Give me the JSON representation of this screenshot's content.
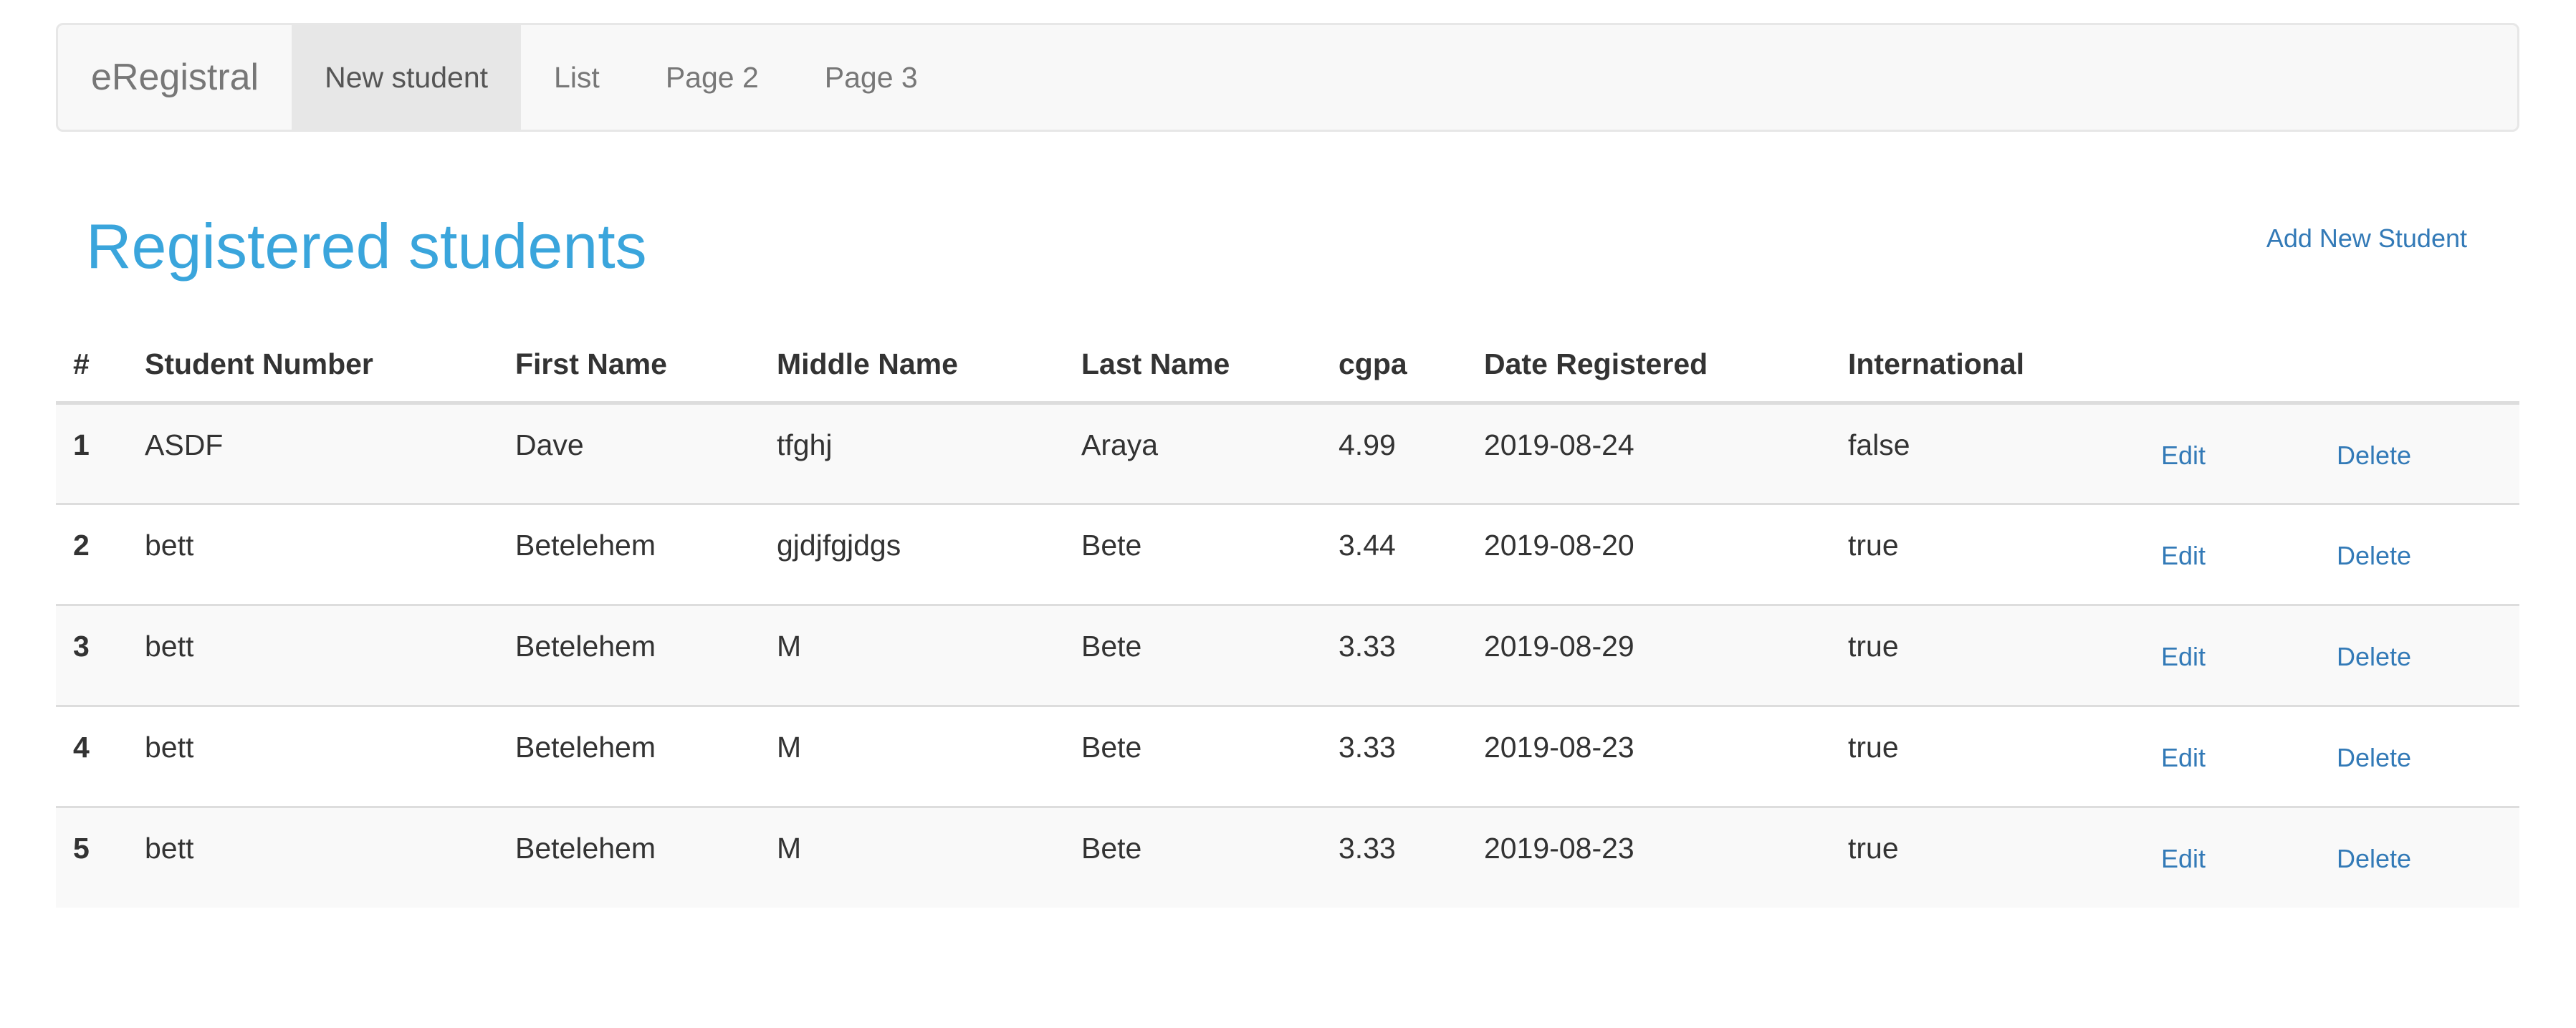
{
  "navbar": {
    "brand": "eRegistral",
    "items": [
      {
        "label": "New student",
        "active": true
      },
      {
        "label": "List"
      },
      {
        "label": "Page 2"
      },
      {
        "label": "Page 3"
      }
    ]
  },
  "page": {
    "title": "Registered students",
    "add_link": "Add New Student"
  },
  "table": {
    "headers": [
      "#",
      "Student Number",
      "First Name",
      "Middle Name",
      "Last Name",
      "cgpa",
      "Date Registered",
      "International",
      "",
      ""
    ],
    "rows": [
      {
        "num": "1",
        "student_number": "ASDF",
        "first_name": "Dave",
        "middle_name": "tfghj",
        "last_name": "Araya",
        "cgpa": "4.99",
        "date_registered": "2019-08-24",
        "international": "false",
        "edit": "Edit",
        "delete": "Delete"
      },
      {
        "num": "2",
        "student_number": "bett",
        "first_name": "Betelehem",
        "middle_name": "gjdjfgjdgs",
        "last_name": "Bete",
        "cgpa": "3.44",
        "date_registered": "2019-08-20",
        "international": "true",
        "edit": "Edit",
        "delete": "Delete"
      },
      {
        "num": "3",
        "student_number": "bett",
        "first_name": "Betelehem",
        "middle_name": "M",
        "last_name": "Bete",
        "cgpa": "3.33",
        "date_registered": "2019-08-29",
        "international": "true",
        "edit": "Edit",
        "delete": "Delete"
      },
      {
        "num": "4",
        "student_number": "bett",
        "first_name": "Betelehem",
        "middle_name": "M",
        "last_name": "Bete",
        "cgpa": "3.33",
        "date_registered": "2019-08-23",
        "international": "true",
        "edit": "Edit",
        "delete": "Delete"
      },
      {
        "num": "5",
        "student_number": "bett",
        "first_name": "Betelehem",
        "middle_name": "M",
        "last_name": "Bete",
        "cgpa": "3.33",
        "date_registered": "2019-08-23",
        "international": "true",
        "edit": "Edit",
        "delete": "Delete"
      }
    ]
  },
  "colors": {
    "title": "#3aa5dc",
    "link": "#337ab7",
    "navbar_bg": "#f8f8f8",
    "active_nav_bg": "#e7e7e7",
    "stripe": "#f9f9f9"
  }
}
